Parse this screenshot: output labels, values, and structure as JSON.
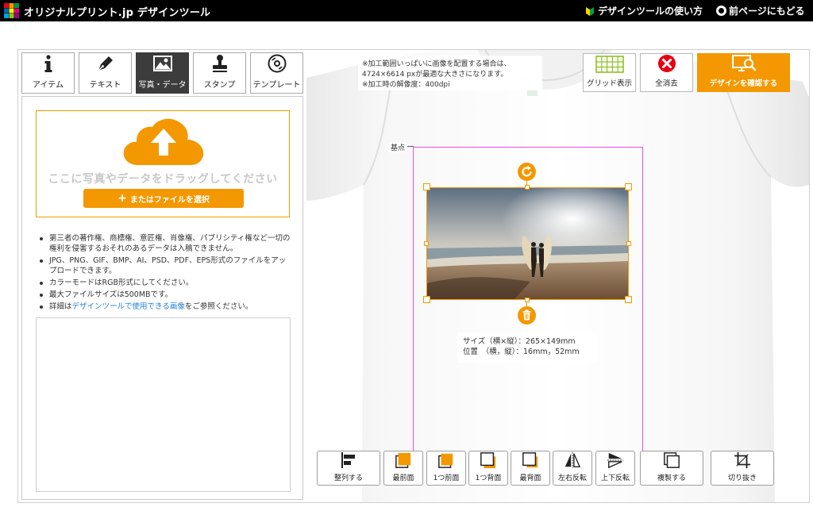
{
  "header": {
    "brand": "オリジナルプリント.jp デザインツール",
    "howto_label": "デザインツールの使い方",
    "back_label": "前ページにもどる"
  },
  "tabs": [
    {
      "label": "アイテム",
      "icon": "info-icon"
    },
    {
      "label": "テキスト",
      "icon": "pen-icon"
    },
    {
      "label": "写真・データ",
      "icon": "image-icon",
      "active": true
    },
    {
      "label": "スタンプ",
      "icon": "stamp-icon"
    },
    {
      "label": "テンプレート",
      "icon": "disc-icon"
    }
  ],
  "upload": {
    "drop_text": "ここに写真やデータをドラッグしてください",
    "file_button": "またはファイルを選択"
  },
  "notes": [
    "第三者の著作権、商標権、意匠権、肖像権、パブリシティ権など一切の権利を侵害するおそれのあるデータは入稿できません。",
    "JPG、PNG、GIF、BMP、AI、PSD、PDF、EPS形式のファイルをアップロードできます。",
    "カラーモードはRGB形式にしてください。",
    "最大ファイルサイズは500MBです。"
  ],
  "notes_detail": {
    "prefix": "詳細は",
    "link": "デザインツールで使用できる画像",
    "suffix": "をご参照ください。"
  },
  "info": {
    "line1": "※加工範囲いっぱいに画像を配置する場合は、",
    "line2": "4724×6614 pxが最適な大きさになります。",
    "line3": "※加工時の解像度：400dpi"
  },
  "toolbar": {
    "grid_label": "グリッド表示",
    "clear_label": "全消去",
    "confirm_label": "デザインを確認する"
  },
  "canvas": {
    "origin_label": "基点",
    "size_line": "サイズ（横×縦）：265×149mm",
    "position_line": "位置　（横，縦）：16mm，52mm"
  },
  "bottom_tools": [
    {
      "label": "整列する",
      "icon": "align-icon"
    },
    {
      "label": "最前面",
      "icon": "bring-front-icon"
    },
    {
      "label": "1つ前面",
      "icon": "bring-forward-icon"
    },
    {
      "label": "1つ背面",
      "icon": "send-backward-icon"
    },
    {
      "label": "最背面",
      "icon": "send-back-icon"
    },
    {
      "label": "左右反転",
      "icon": "flip-horizontal-icon"
    },
    {
      "label": "上下反転",
      "icon": "flip-vertical-icon"
    },
    {
      "label": "複製する",
      "icon": "duplicate-icon"
    },
    {
      "label": "切り抜き",
      "icon": "crop-icon"
    }
  ],
  "colors": {
    "accent": "#f39800",
    "print_area": "#e64ee6",
    "header_bg": "#000000",
    "link": "#1e7fd8"
  }
}
